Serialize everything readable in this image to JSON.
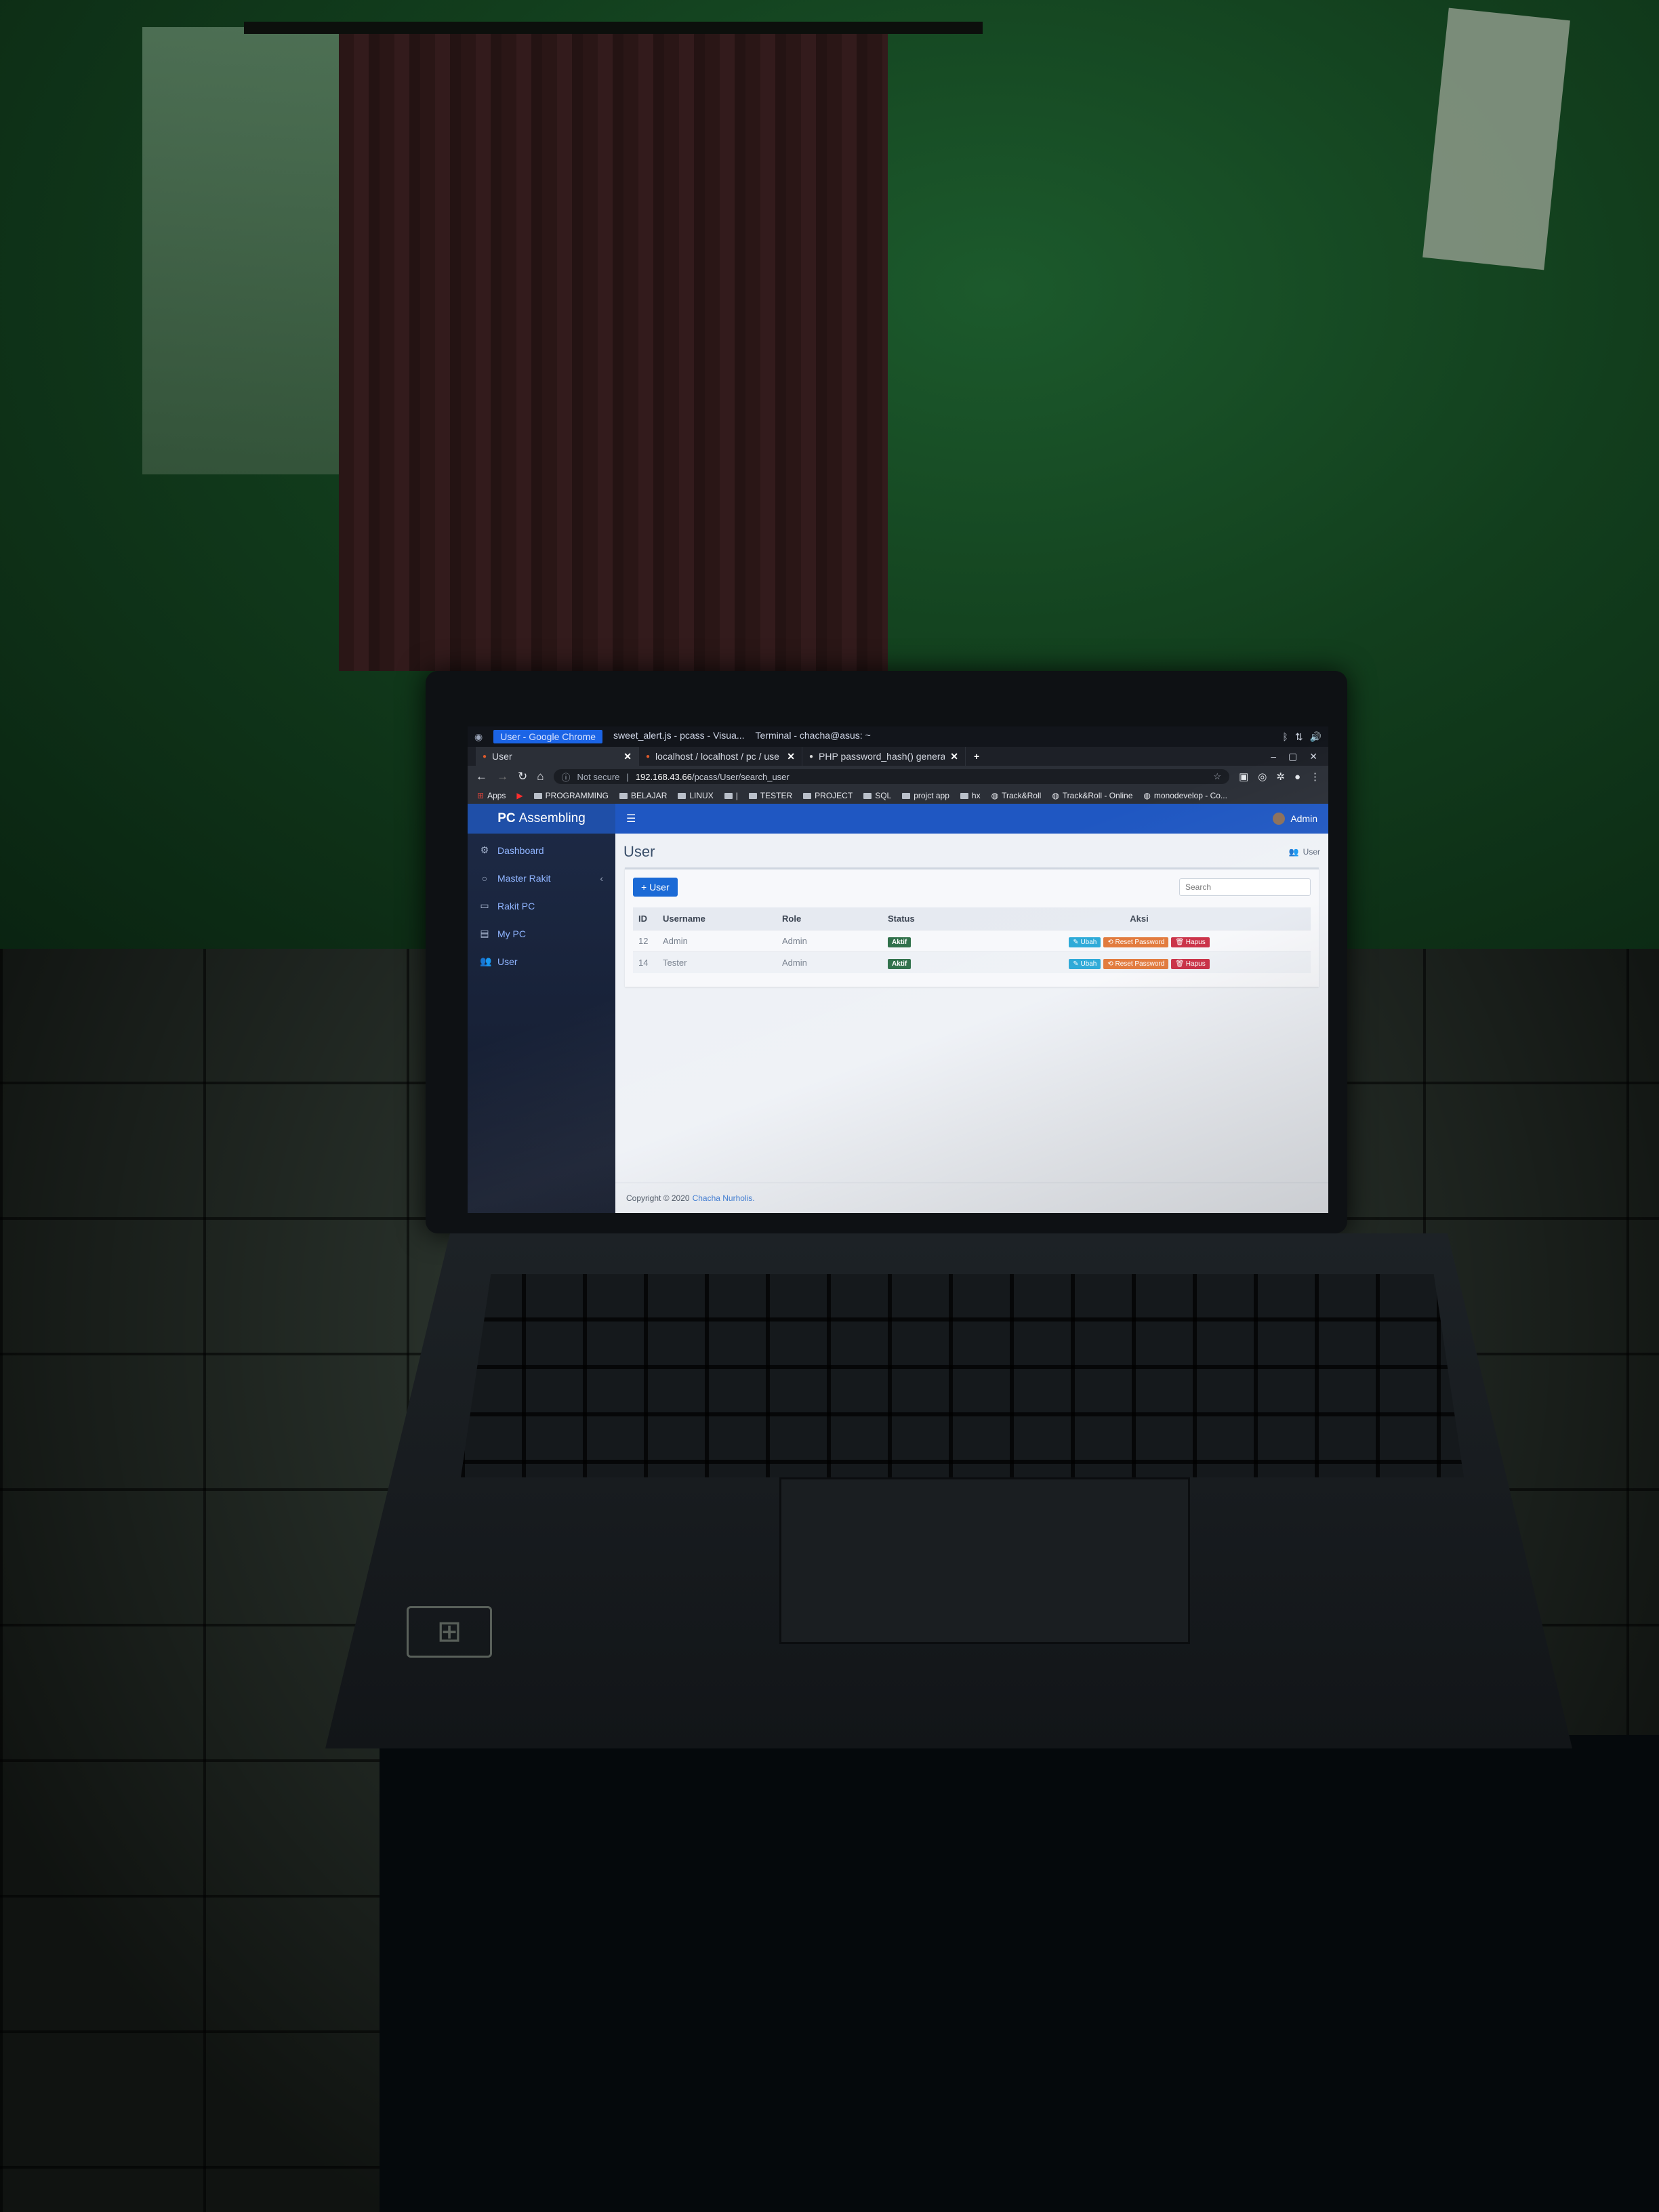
{
  "os": {
    "apps": [
      {
        "label": "User - Google Chrome",
        "active": true
      },
      {
        "label": "sweet_alert.js - pcass - Visua...",
        "active": false
      },
      {
        "label": "Terminal - chacha@asus: ~",
        "active": false
      }
    ]
  },
  "browser": {
    "tabs": [
      {
        "title": "User",
        "active": true
      },
      {
        "title": "localhost / localhost / pc / use",
        "active": false
      },
      {
        "title": "PHP password_hash() generat",
        "active": false
      }
    ],
    "new_tab": "+",
    "security_label": "Not secure",
    "url_host": "192.168.43.66",
    "url_path": "/pcass/User/search_user",
    "bookmarks": [
      {
        "label": "Apps",
        "type": "apps"
      },
      {
        "label": "",
        "type": "youtube"
      },
      {
        "label": "PROGRAMMING",
        "type": "folder"
      },
      {
        "label": "BELAJAR",
        "type": "folder"
      },
      {
        "label": "LINUX",
        "type": "folder"
      },
      {
        "label": "|",
        "type": "folder"
      },
      {
        "label": "TESTER",
        "type": "folder"
      },
      {
        "label": "PROJECT",
        "type": "folder"
      },
      {
        "label": "SQL",
        "type": "folder"
      },
      {
        "label": "projct app",
        "type": "folder"
      },
      {
        "label": "hx",
        "type": "folder"
      },
      {
        "label": "Track&Roll",
        "type": "site"
      },
      {
        "label": "Track&Roll - Online",
        "type": "site"
      },
      {
        "label": "monodevelop - Co...",
        "type": "site"
      }
    ]
  },
  "app": {
    "brand_bold": "PC",
    "brand_rest": "Assembling",
    "sidebar": [
      {
        "label": "Dashboard",
        "icon": "dashboard-icon",
        "glyph": "⚙"
      },
      {
        "label": "Master Rakit",
        "icon": "circle-icon",
        "glyph": "○",
        "has_children": true
      },
      {
        "label": "Rakit PC",
        "icon": "desktop-icon",
        "glyph": "▭"
      },
      {
        "label": "My PC",
        "icon": "database-icon",
        "glyph": "▤"
      },
      {
        "label": "User",
        "icon": "users-icon",
        "glyph": "👥"
      }
    ],
    "topbar_user": "Admin",
    "page_title": "User",
    "breadcrumb": "User",
    "add_button": "+ User",
    "search_placeholder": "Search",
    "table": {
      "headers": [
        "ID",
        "Username",
        "Role",
        "Status",
        "Aksi"
      ],
      "rows": [
        {
          "id": "12",
          "username": "Admin",
          "role": "Admin",
          "status": "Aktif"
        },
        {
          "id": "14",
          "username": "Tester",
          "role": "Admin",
          "status": "Aktif"
        }
      ],
      "actions": {
        "edit": "✎ Ubah",
        "reset": "⟲ Reset Password",
        "delete": "🗑 Hapus"
      }
    },
    "footer_prefix": "Copyright © 2020",
    "footer_author": "Chacha Nurholis."
  },
  "colors": {
    "brand": "#1f4fa8",
    "topbar": "#1f57c2",
    "primary_button": "#1b6ad6",
    "badge_active": "#2d6e48",
    "edit": "#25a6d6",
    "reset": "#e07434",
    "delete": "#c8283f"
  }
}
